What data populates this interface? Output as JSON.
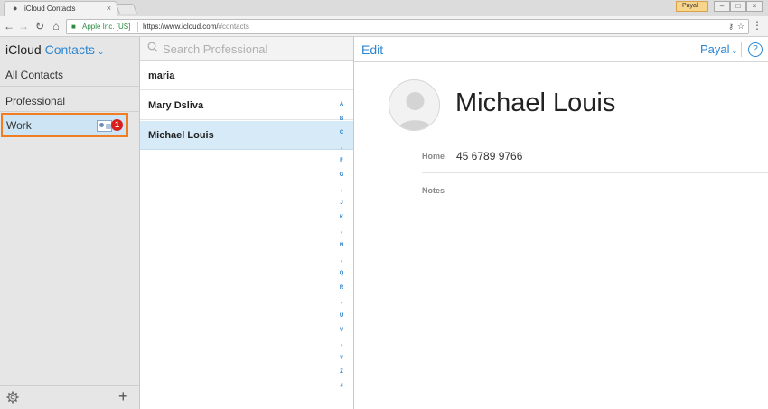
{
  "browser": {
    "tab_title": "iCloud Contacts",
    "tab_close": "×",
    "user_badge": "Payal",
    "window_controls": [
      "–",
      "□",
      "×"
    ],
    "address": {
      "secure_label": "Apple Inc. [US]",
      "url_scheme_host": "https://www.icloud.com/",
      "url_fragment": "#contacts"
    }
  },
  "sidebar": {
    "brand": "iCloud",
    "app_name": "Contacts",
    "groups": [
      {
        "label": "All Contacts"
      },
      {
        "label": "Professional"
      },
      {
        "label": "Work",
        "badge_count": "1"
      }
    ]
  },
  "list": {
    "search_placeholder": "Search Professional",
    "contacts": [
      {
        "name": "maria"
      },
      {
        "name": "Mary Dsliva"
      },
      {
        "name": "Michael Louis",
        "selected": true
      }
    ],
    "index": [
      "A",
      "B",
      "C",
      "•",
      "F",
      "G",
      "•",
      "J",
      "K",
      "•",
      "N",
      "•",
      "Q",
      "R",
      "•",
      "U",
      "V",
      "•",
      "Y",
      "Z",
      "#"
    ]
  },
  "detail": {
    "edit_label": "Edit",
    "user_label": "Payal",
    "help_label": "?",
    "name": "Michael Louis",
    "fields": [
      {
        "label": "Home",
        "value": "45 6789 9766"
      },
      {
        "label": "Notes",
        "value": ""
      }
    ]
  },
  "colors": {
    "accent": "#2c86d0",
    "selection": "#d6eaf7",
    "highlight_border": "#f07d22",
    "badge": "#d61f1f"
  }
}
